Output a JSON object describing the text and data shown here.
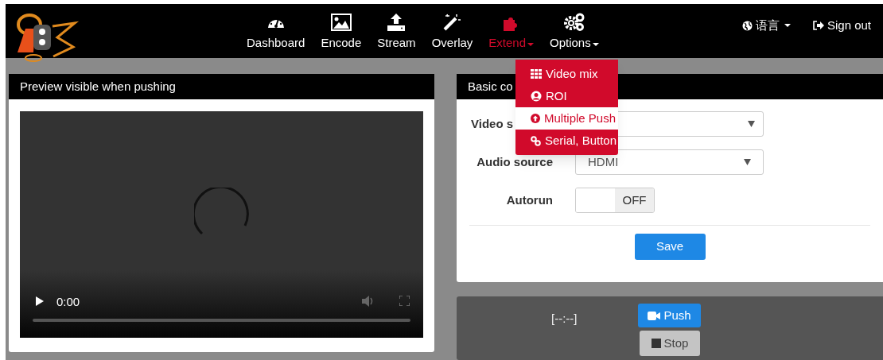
{
  "nav": {
    "items": [
      {
        "label": "Dashboard",
        "selected": false,
        "caret": false
      },
      {
        "label": "Encode",
        "selected": false,
        "caret": false
      },
      {
        "label": "Stream",
        "selected": false,
        "caret": false
      },
      {
        "label": "Overlay",
        "selected": false,
        "caret": false
      },
      {
        "label": "Extend",
        "selected": true,
        "caret": true
      },
      {
        "label": "Options",
        "selected": false,
        "caret": true
      }
    ],
    "language": "语言",
    "sign_out": "Sign out"
  },
  "dropdown": {
    "items": [
      {
        "label": "Video mix",
        "selected": false
      },
      {
        "label": "ROI",
        "selected": false
      },
      {
        "label": "Multiple Push",
        "selected": true
      },
      {
        "label": "Serial, Button",
        "selected": false
      }
    ]
  },
  "preview": {
    "title": "Preview visible when pushing",
    "time": "0:00"
  },
  "basic": {
    "title": "Basic co",
    "video_label": "Video s",
    "audio_label": "Audio source",
    "audio_value": "HDMI",
    "autorun_label": "Autorun",
    "autorun": {
      "on": false,
      "off_label": "OFF"
    },
    "save": "Save"
  },
  "push": {
    "timer": "[--:--]",
    "push": "Push",
    "stop": "Stop"
  }
}
